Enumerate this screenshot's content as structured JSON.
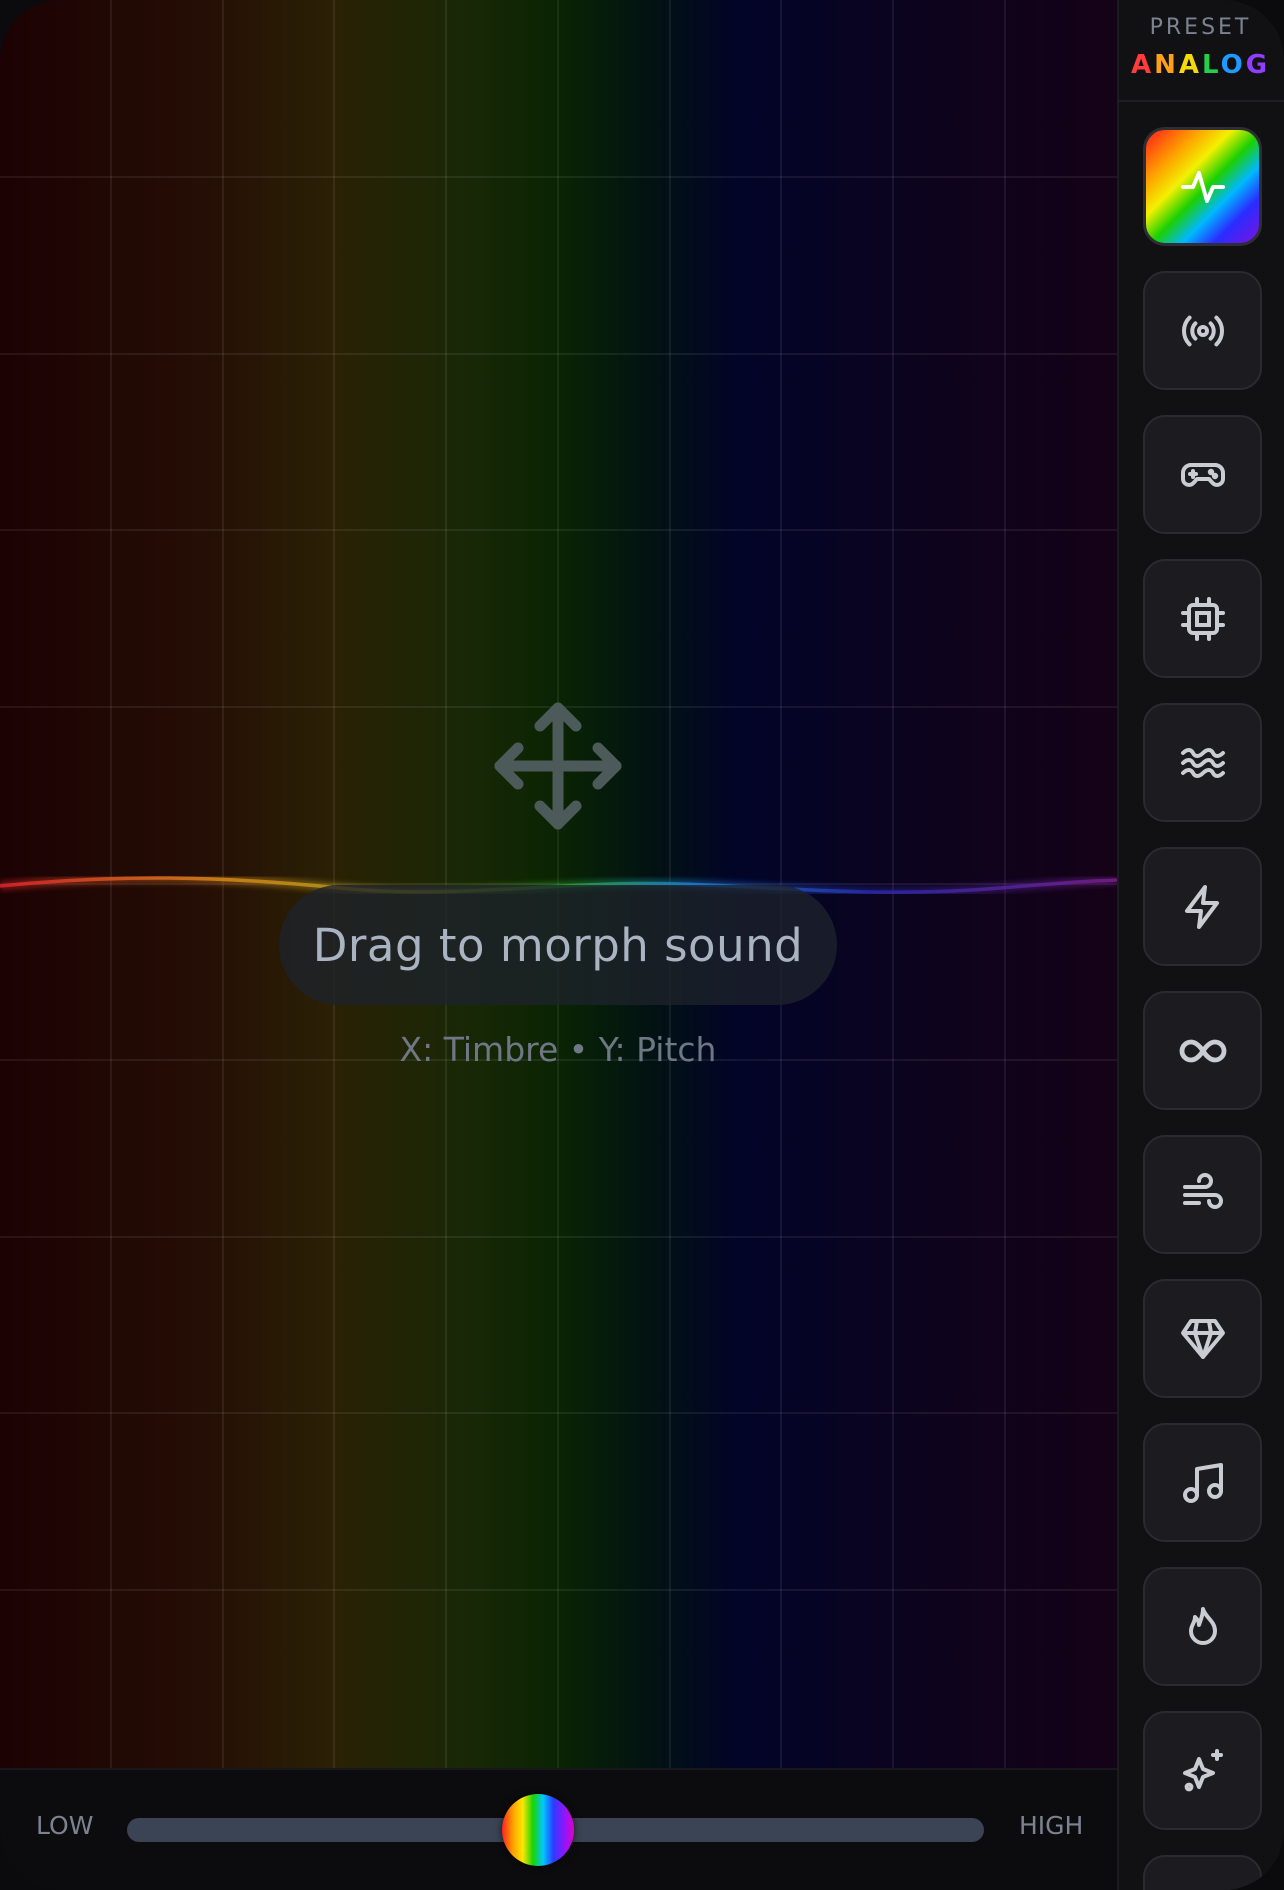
{
  "pad": {
    "hint": "Drag to morph sound",
    "axes_hint": "X: Timbre • Y: Pitch"
  },
  "slider": {
    "low_label": "LOW",
    "high_label": "HIGH",
    "value_fraction": 0.48
  },
  "preset": {
    "label": "PRESET",
    "name_letters": [
      {
        "ch": "A",
        "color": "#ff3b3b"
      },
      {
        "ch": "N",
        "color": "#ff9f1a"
      },
      {
        "ch": "A",
        "color": "#f5d90a"
      },
      {
        "ch": "L",
        "color": "#22d04a"
      },
      {
        "ch": "O",
        "color": "#1e9bff"
      },
      {
        "ch": "G",
        "color": "#8f3dff"
      }
    ]
  },
  "sidebar": {
    "tools": [
      {
        "icon": "pulse-icon",
        "active": true
      },
      {
        "icon": "broadcast-icon",
        "active": false
      },
      {
        "icon": "gamepad-icon",
        "active": false
      },
      {
        "icon": "cpu-chip-icon",
        "active": false
      },
      {
        "icon": "waves-icon",
        "active": false
      },
      {
        "icon": "lightning-icon",
        "active": false
      },
      {
        "icon": "infinity-icon",
        "active": false
      },
      {
        "icon": "wind-icon",
        "active": false
      },
      {
        "icon": "diamond-icon",
        "active": false
      },
      {
        "icon": "music-note-icon",
        "active": false
      },
      {
        "icon": "flame-icon",
        "active": false
      },
      {
        "icon": "sparkles-icon",
        "active": false
      },
      {
        "icon": "more-tool-icon",
        "active": false
      }
    ]
  },
  "colors": {
    "track": "#3a4454",
    "icon_stroke": "#c9ccd3"
  }
}
